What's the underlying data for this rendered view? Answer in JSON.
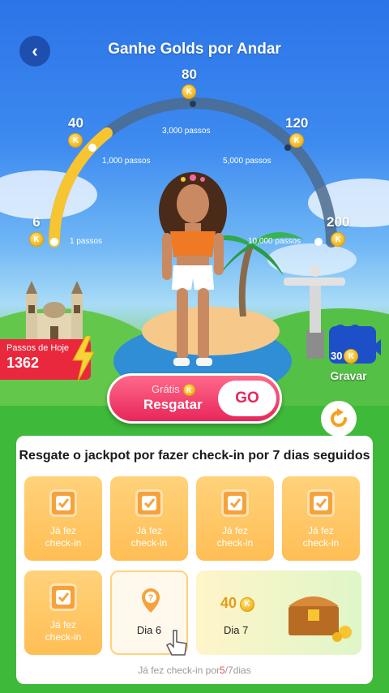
{
  "header": {
    "title": "Ganhe Golds por Andar",
    "back_icon": "chevron-left-icon"
  },
  "gauge": {
    "milestones": [
      {
        "reward": "6",
        "steps": "1 passos"
      },
      {
        "reward": "40",
        "steps": "1,000 passos"
      },
      {
        "reward": "80",
        "steps": "3,000 passos"
      },
      {
        "reward": "120",
        "steps": "5,000 passos"
      },
      {
        "reward": "200",
        "steps": "10,000 passos"
      }
    ],
    "coin_symbol": "K"
  },
  "today": {
    "label": "Passos de Hoje",
    "value": "1362"
  },
  "video": {
    "coins": "30",
    "label": "Gravar"
  },
  "claim": {
    "free_label": "Grátis",
    "name": "Resgatar",
    "go_label": "GO"
  },
  "checkin": {
    "title": "Resgate o jackpot por fazer check-in por 7 dias seguidos",
    "done_label": "Já fez check-in",
    "day6": "Dia 6",
    "day7": "Dia 7",
    "day7_reward": "40",
    "progress_prefix": "Já fez check-in por",
    "progress_current": "5",
    "progress_suffix": "/7dias"
  },
  "colors": {
    "accent": "#e8265b",
    "progress_arc": "#f7c531",
    "arc_bg": "#4c6b8e",
    "card": "#ffc768"
  }
}
